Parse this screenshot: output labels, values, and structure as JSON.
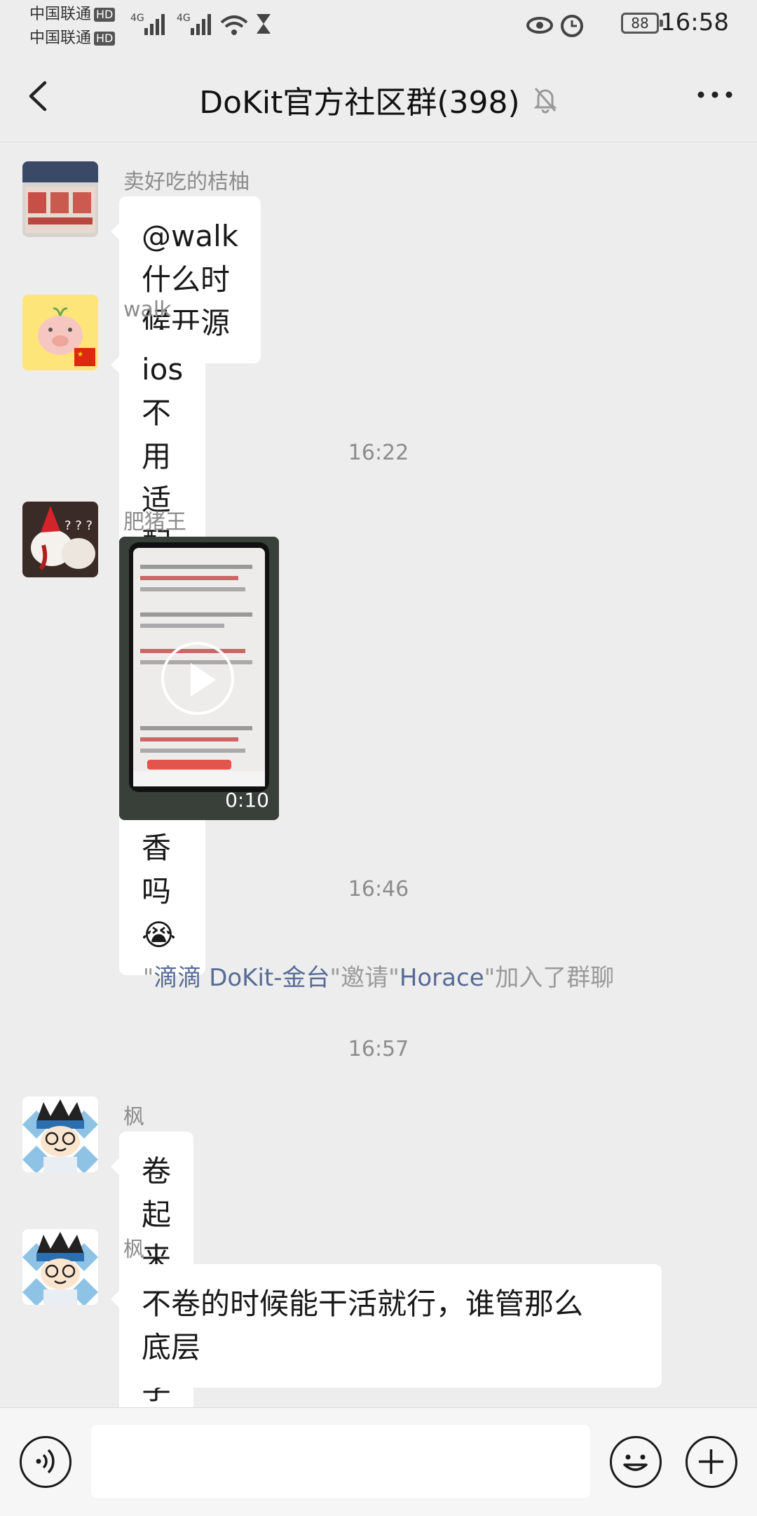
{
  "status_bar": {
    "carrier1": "中国联通",
    "carrier2": "中国联通",
    "hd": "HD",
    "net": "4G",
    "battery": "88",
    "time": "16:58"
  },
  "header": {
    "title": "DoKit官方社区群(398)"
  },
  "messages": [
    {
      "sender": "卖好吃的桔柚",
      "text": "@walk  什么时候开源"
    },
    {
      "sender": "walk",
      "text": "ios 不用适配不用看源码不香吗😭"
    },
    {
      "timestamp": "16:22"
    },
    {
      "sender": "肥猪王",
      "video_duration": "0:10"
    },
    {
      "timestamp": "16:46"
    },
    {
      "system": {
        "q1": "\"",
        "name1": "滴滴 DoKit-金台",
        "q2": "\"邀请\"",
        "name2": "Horace",
        "q3": "\"加入了群聊"
      }
    },
    {
      "timestamp": "16:57"
    },
    {
      "sender": "枫",
      "text": "卷起来都得学"
    },
    {
      "sender": "枫",
      "text_line1": "不卷的时候能干活就行，谁管那么",
      "text_line2": "底层"
    }
  ],
  "colors": {
    "background": "#ededed",
    "bubble": "#ffffff",
    "link_name": "#576b95",
    "meta_text": "#8c8c8c"
  }
}
